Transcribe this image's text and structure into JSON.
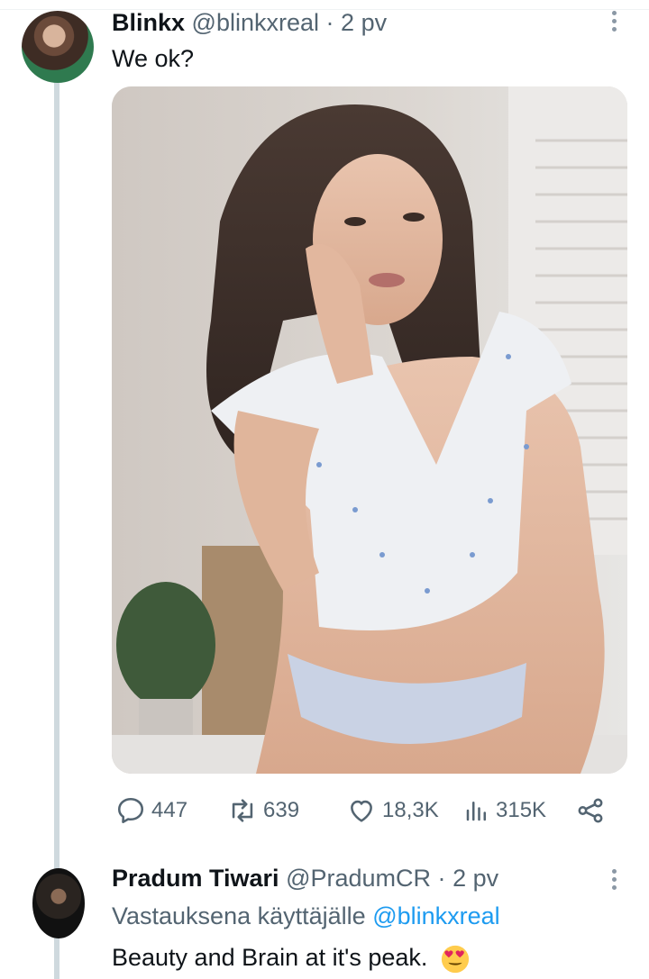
{
  "tweet": {
    "display_name": "Blinkx",
    "handle": "@blinkxreal",
    "separator": "·",
    "time": "2 pv",
    "text": "We ok?",
    "avatar_icon": "profile-photo",
    "media_alt_icon": "photo",
    "actions": {
      "replies": "447",
      "retweets": "639",
      "likes": "18,3K",
      "views": "315K"
    }
  },
  "reply": {
    "display_name": "Pradum Tiwari",
    "handle": "@PradumCR",
    "separator": "·",
    "time": "2 pv",
    "context_prefix": "Vastauksena käyttäjälle",
    "context_mention": "@blinkxreal",
    "text": "Beauty and Brain at it's peak.",
    "emoji_icon": "heart-eyes-emoji"
  },
  "colors": {
    "primary_text": "#0f1419",
    "secondary_text": "#536471",
    "link": "#1d9bf0",
    "thread_line": "#cfd9de"
  }
}
